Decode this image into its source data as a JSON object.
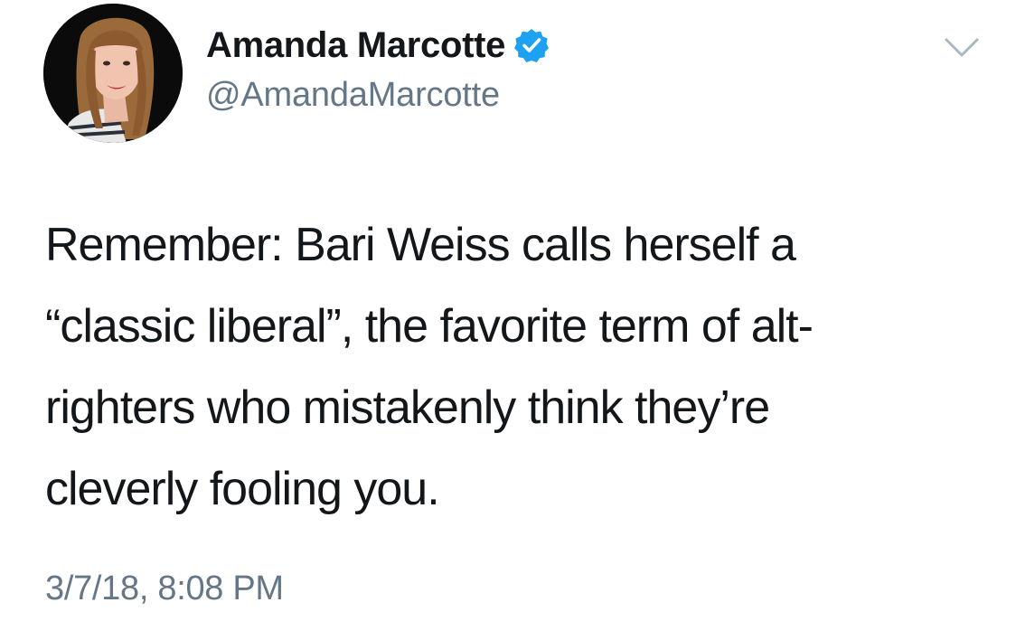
{
  "tweet": {
    "author": {
      "display_name": "Amanda Marcotte",
      "handle": "@AmandaMarcotte",
      "verified": true,
      "avatar_icon": "profile-photo-avatar",
      "verified_icon": "verified-badge-icon"
    },
    "menu_icon": "chevron-down-icon",
    "text_lines": [
      "Remember: Bari Weiss calls herself a",
      "“classic liberal”, the favorite term of alt-",
      "righters who mistakenly think they’re",
      "cleverly fooling you."
    ],
    "timestamp": "3/7/18, 8:08 PM"
  },
  "colors": {
    "text_primary": "#14171a",
    "text_secondary": "#657786",
    "verified_blue": "#1da1f2",
    "caret_gray": "#aab8c2",
    "background": "#ffffff"
  }
}
